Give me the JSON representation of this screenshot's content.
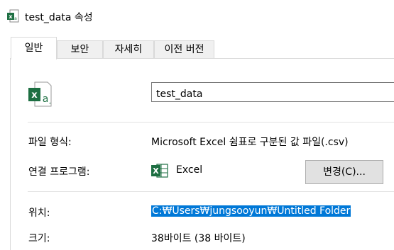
{
  "window": {
    "title": "test_data 속성"
  },
  "tabs": [
    {
      "label": "일반",
      "active": true
    },
    {
      "label": "보안",
      "active": false
    },
    {
      "label": "자세히",
      "active": false
    },
    {
      "label": "이전 버전",
      "active": false
    }
  ],
  "general": {
    "file_name": "test_data",
    "file_type_label": "파일 형식:",
    "file_type_value": "Microsoft Excel 쉼표로 구분된 값 파일(.csv)",
    "open_with_label": "연결 프로그램:",
    "open_with_value": "Excel",
    "change_button": "변경(C)...",
    "location_label": "위치:",
    "location_value": "C:₩Users₩jungsooyun₩Untitled Folder",
    "size_label": "크기:",
    "size_value": "38바이트 (38 바이트)"
  },
  "icons": {
    "title": "excel-csv-icon",
    "file": "excel-csv-icon",
    "app": "excel-icon"
  },
  "colors": {
    "excel_green": "#1d6f42",
    "selection": "#0078d7"
  }
}
